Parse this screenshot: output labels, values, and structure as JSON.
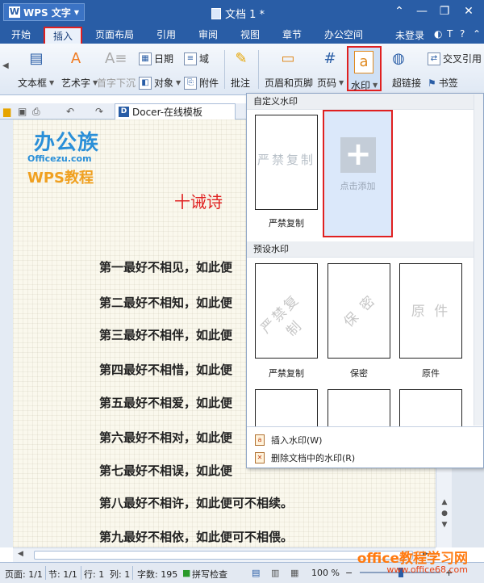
{
  "titlebar": {
    "app_name": "WPS 文字",
    "app_logo": "W",
    "doc_title": "文档 1 *",
    "controls": [
      "⌃",
      "—",
      "❐",
      "✕"
    ]
  },
  "tabs": [
    "开始",
    "插入",
    "页面布局",
    "引用",
    "审阅",
    "视图",
    "章节",
    "办公空间"
  ],
  "tab_active": "插入",
  "tab_right": {
    "login": "未登录",
    "icons": [
      "◐",
      "T",
      "?",
      "⌃"
    ]
  },
  "ribbon": {
    "textbox": "文本框",
    "wordart": "艺术字",
    "dropcap": "首字下沉",
    "date": "日期",
    "object": "对象",
    "field": "域",
    "attachment": "附件",
    "comment": "批注",
    "header_footer": "页眉和页脚",
    "page_number": "页码",
    "watermark": "水印",
    "hyperlink": "超链接",
    "crossref": "交叉引用",
    "bookmark": "书签"
  },
  "doc_tab": {
    "label": "Docer-在线模板",
    "icon": "D"
  },
  "document": {
    "brand_1": "办公族",
    "brand_2": "Officezu.com",
    "brand_3": "WPS教程",
    "poem_title": "十诫诗",
    "lines": [
      "第一最好不相见，如此便",
      "第二最好不相知，如此便",
      "第三最好不相伴，如此便",
      "第四最好不相惜，如此便",
      "第五最好不相爱，如此便",
      "第六最好不相对，如此便",
      "第七最好不相误，如此便",
      "第八最好不相许，如此便可不相续。",
      "第九最好不相依，如此便可不相偎。"
    ]
  },
  "dropdown": {
    "custom_header": "自定义水印",
    "custom_item_watermark": "严禁复制",
    "custom_item_label": "严禁复制",
    "add_label": "点击添加",
    "preset_header": "预设水印",
    "presets": [
      {
        "label": "严禁复制",
        "watermark": "严禁复制"
      },
      {
        "label": "保密",
        "watermark": "保 密"
      },
      {
        "label": "原件",
        "watermark": "原 件"
      }
    ],
    "menu": [
      "插入水印(W)",
      "删除文档中的水印(R)"
    ]
  },
  "statusbar": {
    "page": "页面: 1/1",
    "section": "节: 1/1",
    "row": "行: 1",
    "col": "列: 1",
    "words": "字数: 195",
    "spellcheck": "拼写检查",
    "zoom": "100 %",
    "zoom_minus": "−",
    "zoom_plus": "+"
  },
  "site_watermark": {
    "line1": "office教程学习网",
    "line2": "www.office68.com"
  },
  "colors": {
    "accent": "#295da6",
    "highlight": "#e02020",
    "title_red": "#e02020"
  }
}
